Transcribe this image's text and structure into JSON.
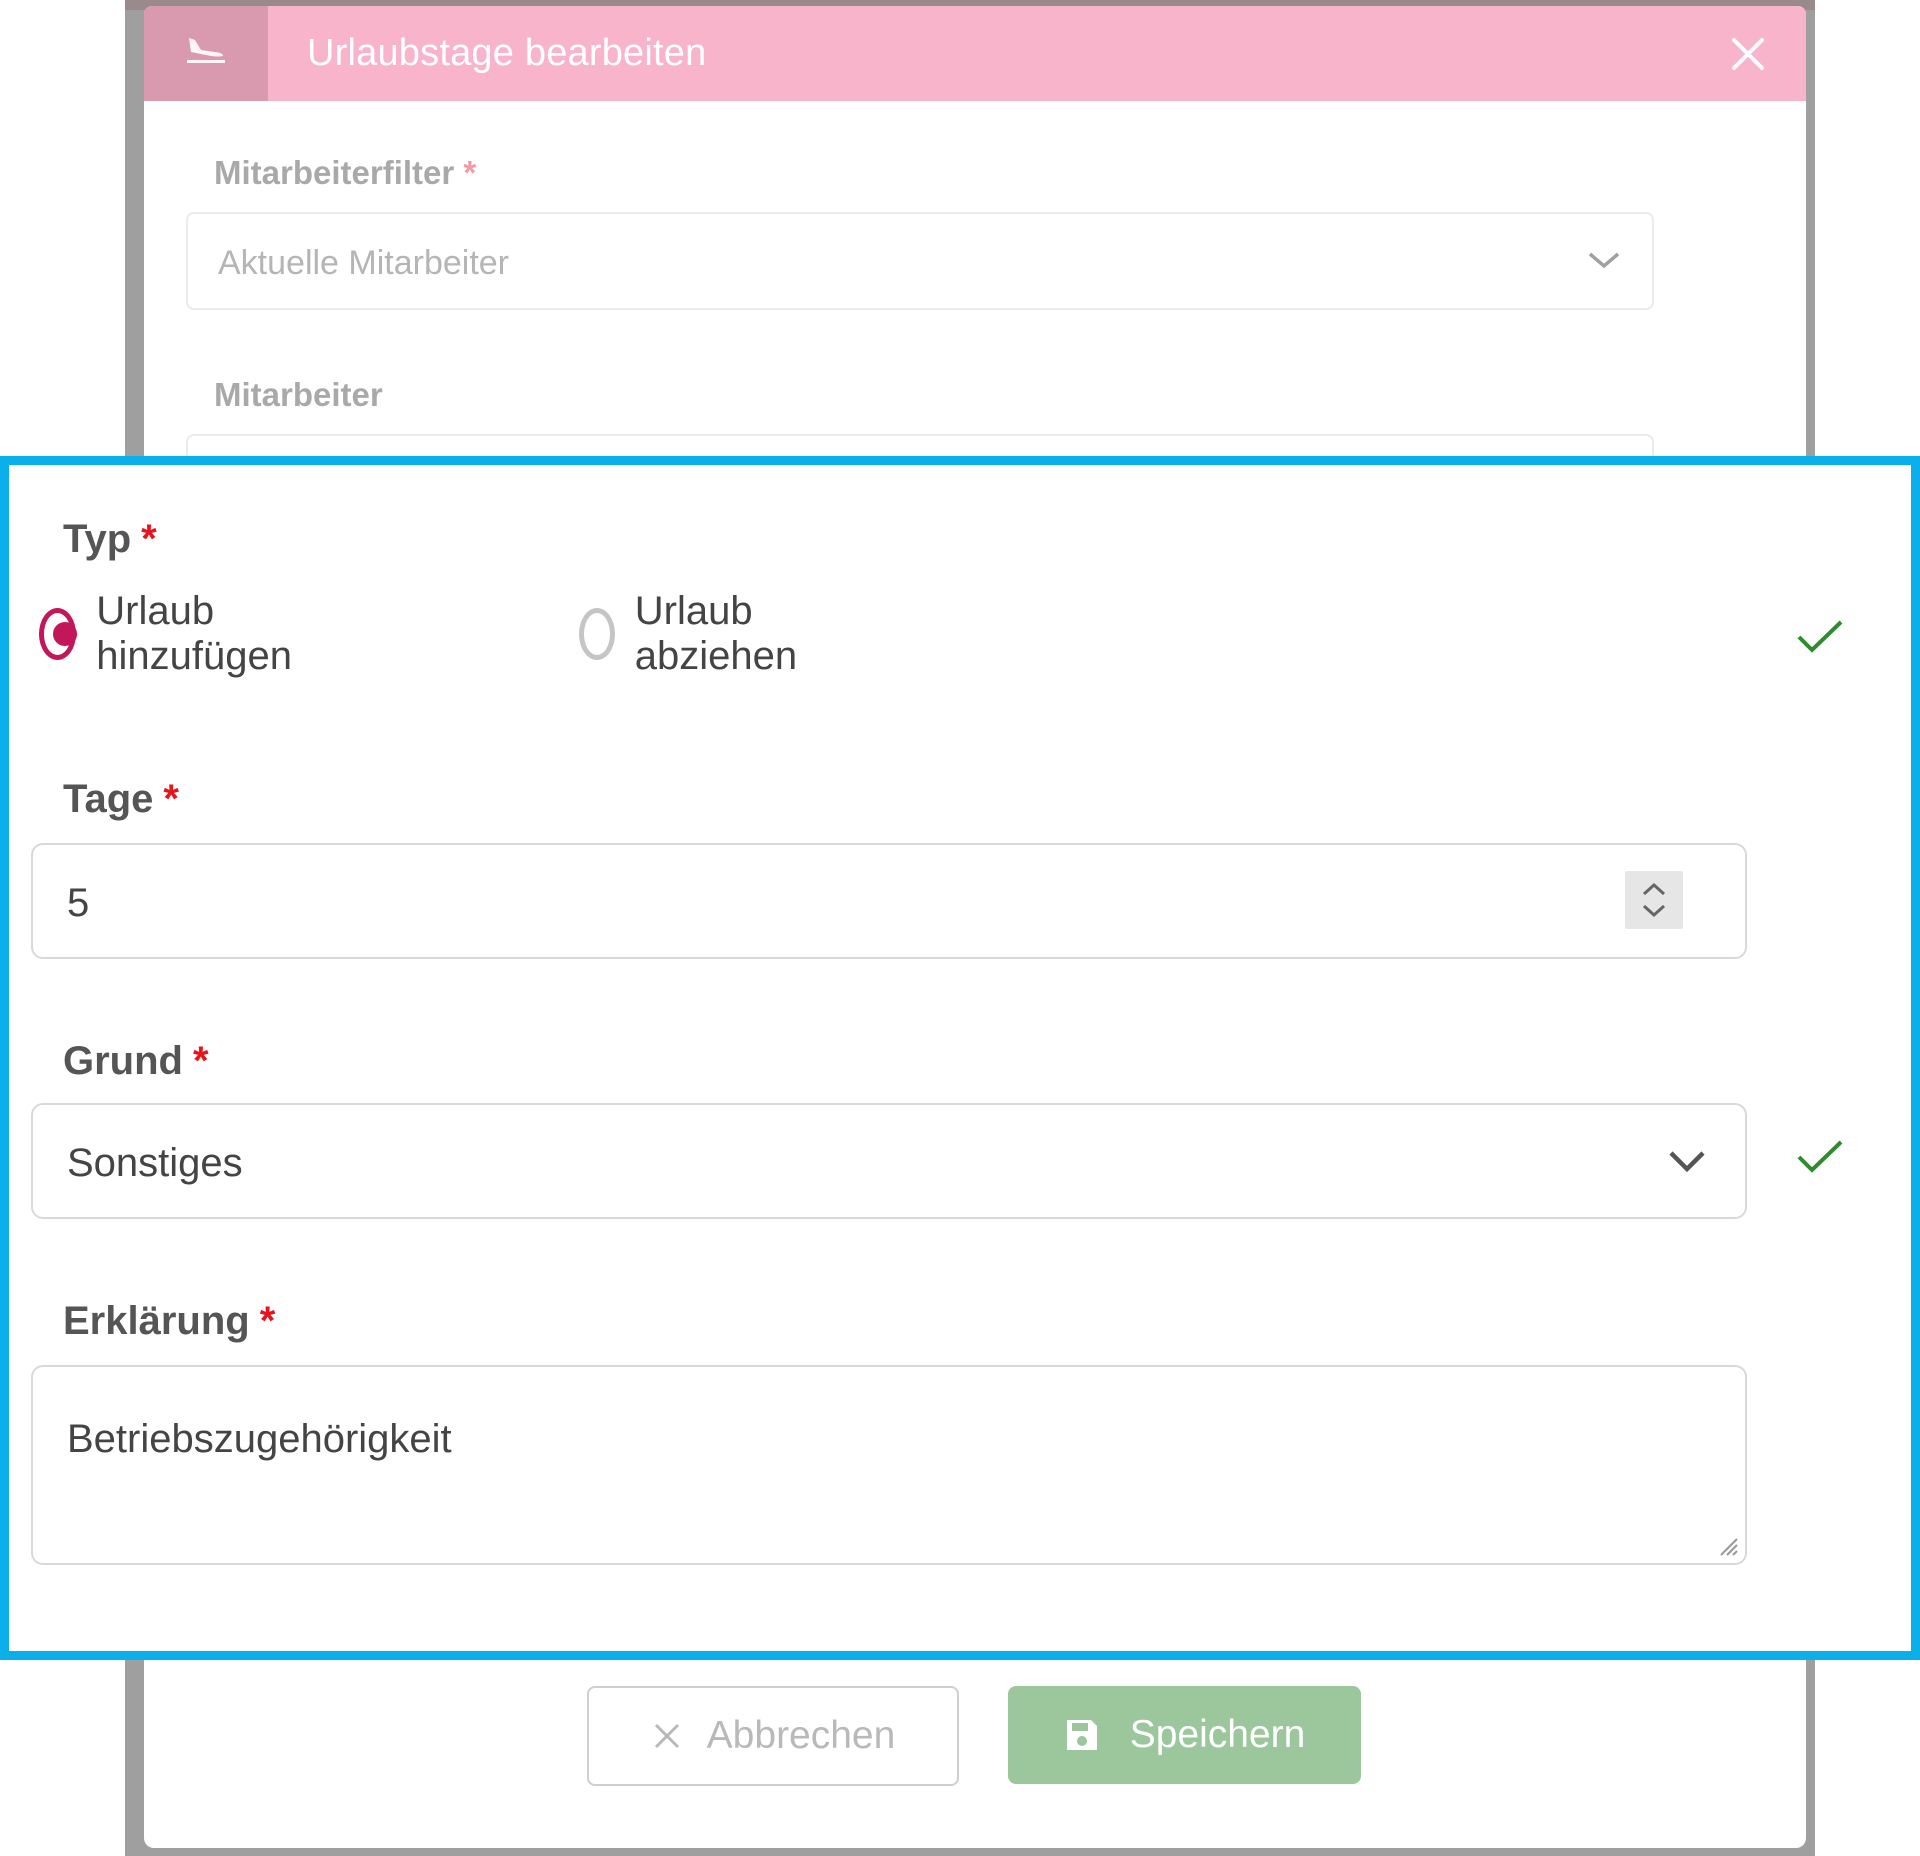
{
  "modal": {
    "title": "Urlaubstage bearbeiten",
    "header_icon": "plane-landing-icon",
    "close_icon": "close-icon",
    "colors": {
      "header": "#f8b0c8",
      "accent": "#c2185b",
      "save": "#9cc69b",
      "highlight": "#0bb0ea",
      "required": "#e8131b",
      "valid": "#2e8b2e"
    }
  },
  "filter": {
    "label": "Mitarbeiterfilter",
    "required_mark": "*",
    "value": "Aktuelle Mitarbeiter"
  },
  "employee": {
    "label": "Mitarbeiter"
  },
  "type": {
    "label": "Typ",
    "required_mark": "*",
    "options": [
      {
        "label": "Urlaub hinzufügen",
        "checked": true
      },
      {
        "label": "Urlaub abziehen",
        "checked": false
      }
    ]
  },
  "days": {
    "label": "Tage",
    "required_mark": "*",
    "value": "5"
  },
  "reason": {
    "label": "Grund",
    "required_mark": "*",
    "value": "Sonstiges"
  },
  "explanation": {
    "label": "Erklärung",
    "required_mark": "*",
    "value": "Betriebszugehörigkeit"
  },
  "footer": {
    "cancel_label": "Abbrechen",
    "save_label": "Speichern"
  }
}
